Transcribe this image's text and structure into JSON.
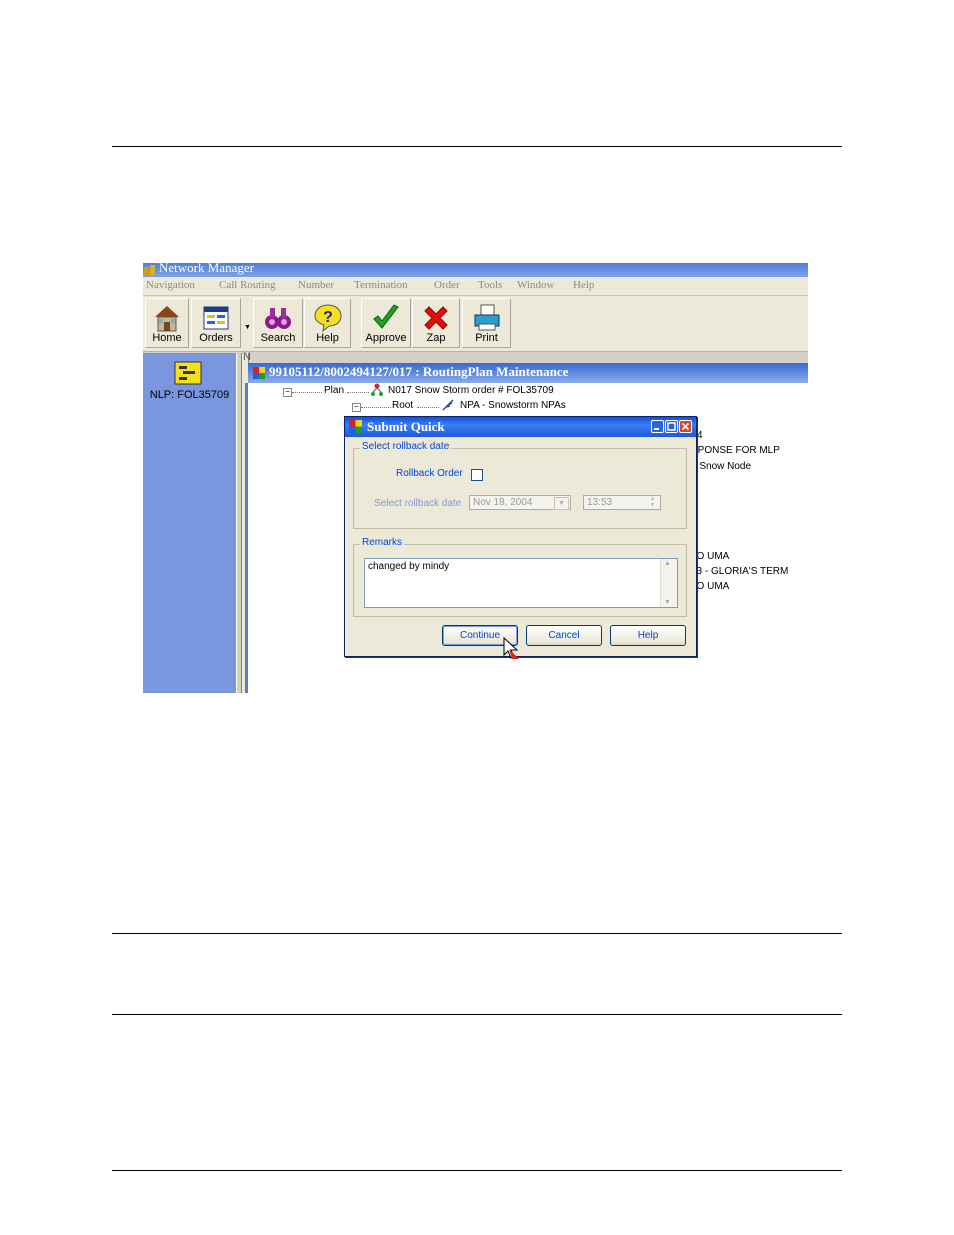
{
  "app": {
    "title": "Network Manager",
    "menu": [
      "Navigation",
      "Call Routing",
      "Number",
      "Termination",
      "Order",
      "Tools",
      "Window",
      "Help"
    ],
    "toolbar": [
      "Home",
      "Orders",
      "Search",
      "Help",
      "Approve",
      "Zap",
      "Print"
    ]
  },
  "left_panel": {
    "label": "NLP: FOL35709"
  },
  "child_window": {
    "title": "99105112/8002494127/017 : RoutingPlan Maintenance",
    "mdi_char": "N",
    "tree": {
      "plan_label": "Plan",
      "plan_node": "N017   Snow Storm  order #  FOL35709",
      "root_label": "Root",
      "root_node": "NPA - Snowstorm NPAs"
    },
    "behind_text": [
      "4",
      "SPONSE FOR MLP",
      "p Snow Node",
      "LO UMA",
      "23 - GLORIA'S TERM",
      "LO UMA"
    ]
  },
  "dialog": {
    "title": "Submit Quick",
    "group_rollback": "Select rollback date",
    "rollback_order_label": "Rollback Order",
    "rollback_date_label": "Select rollback date",
    "date_value": "Nov 18, 2004",
    "time_value": "13:53",
    "group_remarks": "Remarks",
    "remarks_value": "changed by mindy",
    "buttons": {
      "continue": "Continue",
      "cancel": "Cancel",
      "help": "Help"
    }
  },
  "colors": {
    "accent": "#0046d5",
    "titlebar": "#1150e0",
    "left_panel": "#7a96df"
  }
}
